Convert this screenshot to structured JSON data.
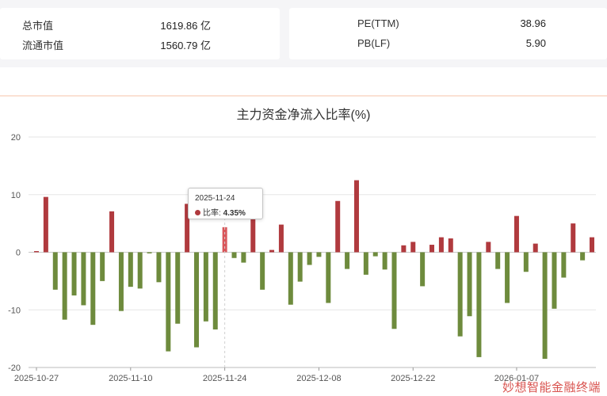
{
  "metrics": {
    "left": [
      {
        "label": "总市值",
        "value": "1619.86 亿"
      },
      {
        "label": "流通市值",
        "value": "1560.79 亿"
      }
    ],
    "right": [
      {
        "label": "PE(TTM)",
        "value": "38.96"
      },
      {
        "label": "PB(LF)",
        "value": "5.90"
      }
    ]
  },
  "tooltip": {
    "date": "2025-11-24",
    "label": "比率:",
    "value": "4.35%"
  },
  "watermark": "妙想智能金融终端",
  "colors": {
    "positive": "#b03a3e",
    "negative": "#6e8b3d",
    "highlight": "#d9565a"
  },
  "chart_data": {
    "type": "bar",
    "title": "主力资金净流入比率(%)",
    "xlabel": "",
    "ylabel": "",
    "ylim": [
      -20,
      20
    ],
    "yticks": [
      -20,
      -10,
      0,
      10,
      20
    ],
    "grid": true,
    "highlighted_category": "2025-11-24",
    "x_tick_labels": [
      "2025-10-27",
      "2025-11-10",
      "2025-11-24",
      "2025-12-08",
      "2025-12-22",
      "2026-01-07"
    ],
    "categories": [
      "2025-10-27",
      "2025-10-28",
      "2025-10-29",
      "2025-10-30",
      "2025-10-31",
      "2025-11-03",
      "2025-11-04",
      "2025-11-05",
      "2025-11-06",
      "2025-11-07",
      "2025-11-10",
      "2025-11-11",
      "2025-11-12",
      "2025-11-13",
      "2025-11-14",
      "2025-11-17",
      "2025-11-18",
      "2025-11-19",
      "2025-11-20",
      "2025-11-21",
      "2025-11-24",
      "2025-11-25",
      "2025-11-26",
      "2025-11-27",
      "2025-11-28",
      "2025-12-01",
      "2025-12-02",
      "2025-12-03",
      "2025-12-04",
      "2025-12-05",
      "2025-12-08",
      "2025-12-09",
      "2025-12-10",
      "2025-12-11",
      "2025-12-12",
      "2025-12-15",
      "2025-12-16",
      "2025-12-17",
      "2025-12-18",
      "2025-12-19",
      "2025-12-22",
      "2025-12-23",
      "2025-12-24",
      "2025-12-25",
      "2025-12-26",
      "2025-12-29",
      "2025-12-30",
      "2025-12-31",
      "2026-01-02",
      "2026-01-05",
      "2026-01-06",
      "2026-01-07",
      "2026-01-08",
      "2026-01-09",
      "2026-01-12",
      "2026-01-13",
      "2026-01-14",
      "2026-01-15",
      "2026-01-16",
      "2026-01-19"
    ],
    "values": [
      0.2,
      9.6,
      -6.5,
      -11.7,
      -7.5,
      -9.2,
      -12.6,
      -5.0,
      7.1,
      -10.2,
      -6.0,
      -6.3,
      -0.2,
      -5.2,
      -17.2,
      -12.4,
      8.4,
      -16.5,
      -12.0,
      -13.4,
      4.35,
      -1.0,
      -1.8,
      7.0,
      -6.5,
      0.4,
      4.8,
      -9.1,
      -5.1,
      -2.2,
      -0.8,
      -8.8,
      8.9,
      -2.9,
      12.5,
      -3.9,
      -0.7,
      -3.0,
      -13.3,
      1.2,
      1.8,
      -5.9,
      1.3,
      2.6,
      2.4,
      -14.6,
      -11.1,
      -18.2,
      1.8,
      -2.9,
      -8.8,
      6.3,
      -3.4,
      1.5,
      -18.5,
      -9.8,
      -4.4,
      5.0,
      -1.4,
      2.6
    ]
  }
}
